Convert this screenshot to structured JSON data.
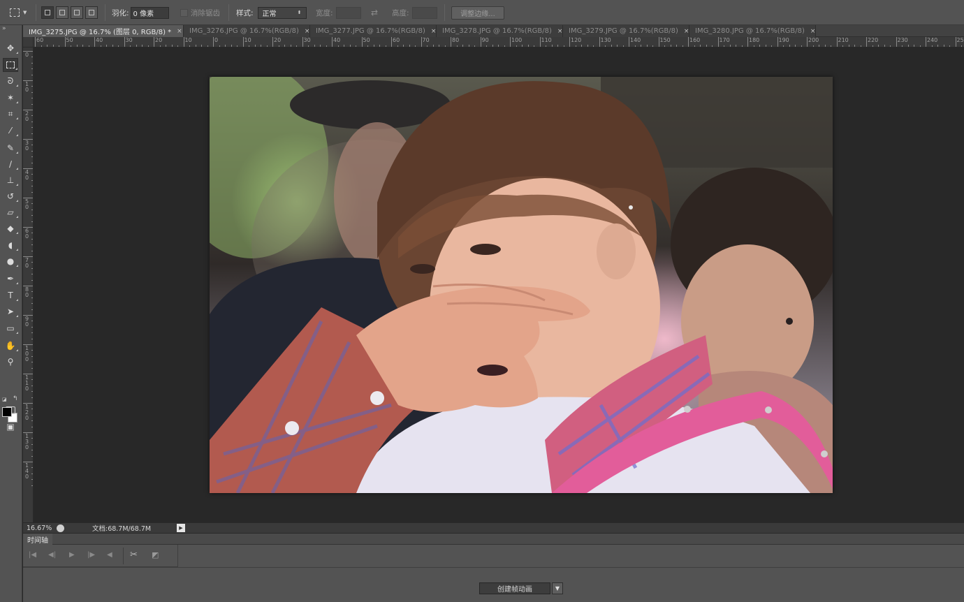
{
  "options_bar": {
    "feather_label": "羽化:",
    "feather_value": "0 像素",
    "antialias_label": "消除锯齿",
    "style_label": "样式:",
    "style_value": "正常",
    "width_label": "宽度:",
    "height_label": "高度:",
    "swap_icon": "⇄",
    "refine_edge_label": "调整边缘..."
  },
  "tabs": [
    {
      "label": "IMG_3275.JPG @ 16.7% (图层 0, RGB/8) *",
      "active": true
    },
    {
      "label": "IMG_3276.JPG @ 16.7%(RGB/8)",
      "active": false
    },
    {
      "label": "IMG_3277.JPG @ 16.7%(RGB/8)",
      "active": false
    },
    {
      "label": "IMG_3278.JPG @ 16.7%(RGB/8)",
      "active": false
    },
    {
      "label": "IMG_3279.JPG @ 16.7%(RGB/8)",
      "active": false
    },
    {
      "label": "IMG_3280.JPG @ 16.7%(RGB/8)",
      "active": false
    }
  ],
  "tab_close_glyph": "×",
  "ruler_h_labels": [
    "60",
    "50",
    "40",
    "30",
    "20",
    "10",
    "0",
    "10",
    "20",
    "30",
    "40",
    "50",
    "60",
    "70",
    "80",
    "90",
    "100",
    "110",
    "120",
    "130",
    "140",
    "150",
    "160",
    "170",
    "180",
    "190",
    "200",
    "210",
    "220",
    "230",
    "240",
    "250"
  ],
  "ruler_v_labels": [
    "0",
    "1 0",
    "2 0",
    "3 0",
    "4 0",
    "5 0",
    "6 0",
    "7 0",
    "8 0",
    "9 0",
    "1 0 0",
    "1 1 0",
    "1 2 0",
    "1 3 0",
    "1 4 0"
  ],
  "status": {
    "zoom": "16.67%",
    "doc": "文档:68.7M/68.7M",
    "arrow": "▶"
  },
  "timeline": {
    "title": "时间轴",
    "create_label": "创建帧动画",
    "dropdown_glyph": "▼"
  },
  "tools": {
    "collapse_glyph": "»"
  }
}
